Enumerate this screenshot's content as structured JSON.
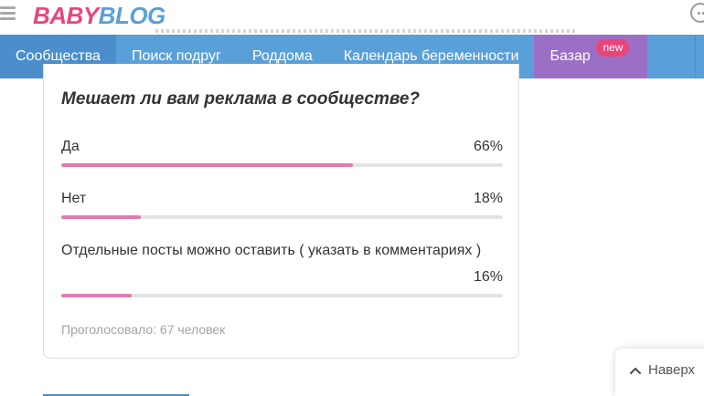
{
  "header": {
    "logo_text": "BABYBLOG"
  },
  "nav": {
    "items": [
      {
        "label": "Сообщества"
      },
      {
        "label": "Поиск подруг"
      },
      {
        "label": "Роддома"
      },
      {
        "label": "Календарь беременности"
      },
      {
        "label": "Базар",
        "badge": "new"
      }
    ],
    "active_index": 0,
    "active_color": "#4a8fcb",
    "bar_color": "#5aa0d8",
    "bazar_color": "#9c6fc7",
    "badge_color": "#e8457b"
  },
  "poll": {
    "question": "Мешает ли вам реклама в сообществе?",
    "options": [
      {
        "label": "Да",
        "percent_text": "66%",
        "value": 66
      },
      {
        "label": "Нет",
        "percent_text": "18%",
        "value": 18
      },
      {
        "label": "Отдельные посты можно оставить ( указать в комментариях )",
        "percent_text": "16%",
        "value": 16
      }
    ],
    "voted_text": "Проголосовало: 67 человек",
    "bar_color": "#e07ab2"
  },
  "scroll_top": {
    "label": "Наверх"
  }
}
